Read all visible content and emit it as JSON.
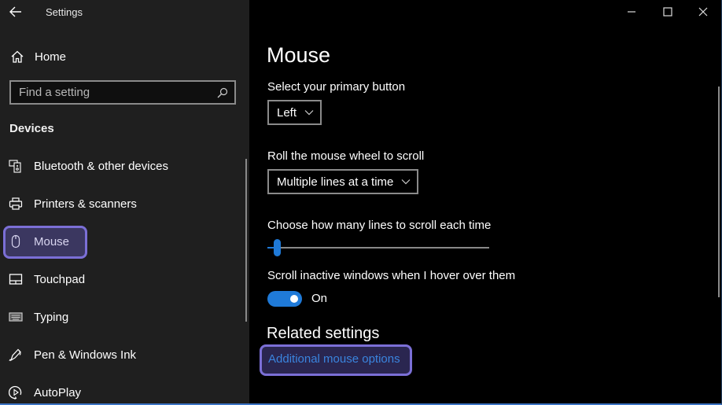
{
  "window": {
    "app_title": "Settings",
    "controls": {
      "minimize_icon": "minimize-icon",
      "maximize_icon": "maximize-icon",
      "close_icon": "close-icon"
    }
  },
  "sidebar": {
    "back_icon": "back-arrow-icon",
    "home": {
      "label": "Home",
      "icon": "home-icon"
    },
    "search": {
      "placeholder": "Find a setting",
      "value": "",
      "icon": "search-icon"
    },
    "section_title": "Devices",
    "items": [
      {
        "label": "Bluetooth & other devices",
        "icon": "bluetooth-devices-icon",
        "selected": false
      },
      {
        "label": "Printers & scanners",
        "icon": "printer-icon",
        "selected": false
      },
      {
        "label": "Mouse",
        "icon": "mouse-icon",
        "selected": true
      },
      {
        "label": "Touchpad",
        "icon": "touchpad-icon",
        "selected": false
      },
      {
        "label": "Typing",
        "icon": "keyboard-icon",
        "selected": false
      },
      {
        "label": "Pen & Windows Ink",
        "icon": "pen-icon",
        "selected": false
      },
      {
        "label": "AutoPlay",
        "icon": "autoplay-icon",
        "selected": false
      }
    ]
  },
  "main": {
    "title": "Mouse",
    "primary_button": {
      "label": "Select your primary button",
      "value": "Left"
    },
    "wheel_scroll": {
      "label": "Roll the mouse wheel to scroll",
      "value": "Multiple lines at a time"
    },
    "lines_to_scroll": {
      "label": "Choose how many lines to scroll each time",
      "value_fraction": 0.03
    },
    "scroll_inactive": {
      "label": "Scroll inactive windows when I hover over them",
      "state": "On"
    },
    "related": {
      "title": "Related settings",
      "link": "Additional mouse options"
    }
  },
  "colors": {
    "accent": "#1f7ad8",
    "highlight_ring": "#7b6fd6",
    "link": "#3a84de",
    "sidebar_bg": "#1f1f1f",
    "main_bg": "#000000"
  }
}
